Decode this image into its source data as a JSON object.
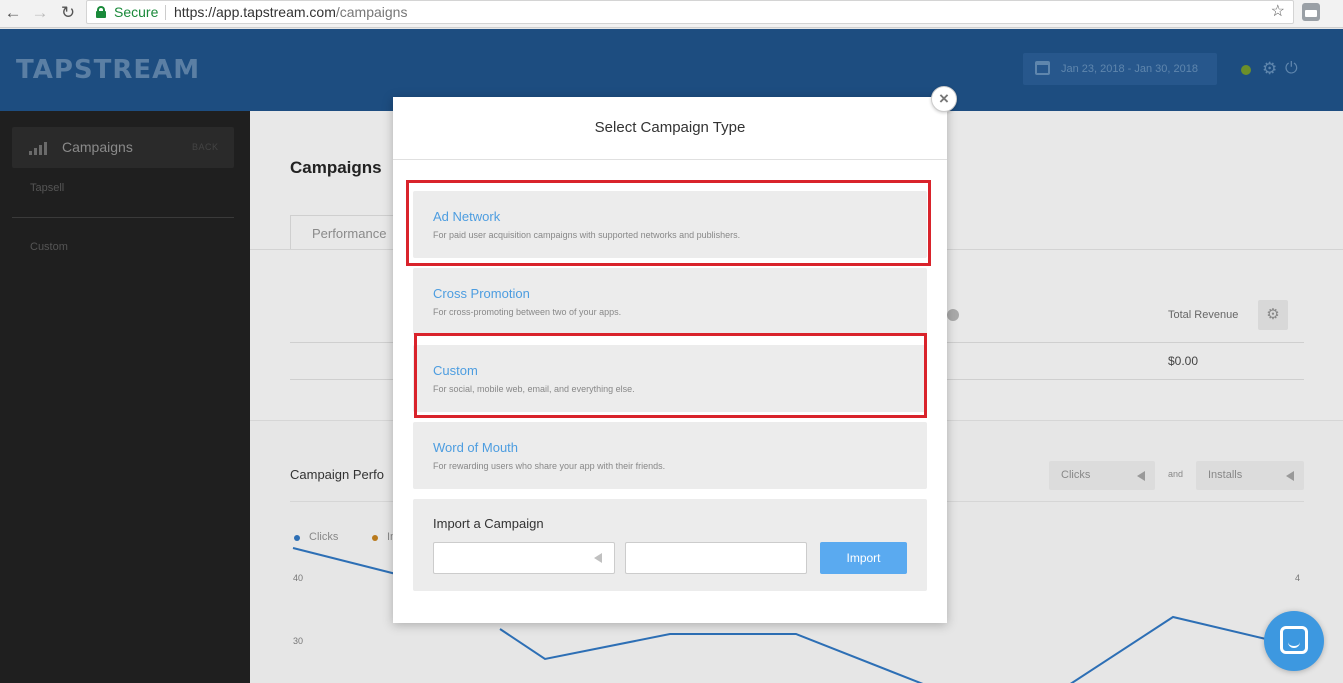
{
  "browser": {
    "secure_label": "Secure",
    "url_host": "https://app.tapstream.com",
    "url_path": "/campaigns"
  },
  "header": {
    "logo": "TAPSTREAM",
    "date_range": "Jan 23, 2018 - Jan 30, 2018"
  },
  "sidebar": {
    "campaigns_label": "Campaigns",
    "back_label": "BACK",
    "account": "Tapsell",
    "custom": "Custom"
  },
  "main": {
    "title": "Campaigns",
    "tab_performance": "Performance",
    "col_total_revenue": "Total Revenue",
    "row_total_revenue": "$0.00",
    "chart_title": "Campaign Perfo",
    "metric_a": "Clicks",
    "and": "and",
    "metric_b": "Installs",
    "legend_clicks": "Clicks",
    "legend_installs": "In",
    "y_left_top": "40",
    "y_left_bottom": "30",
    "y_right_top": "4"
  },
  "modal": {
    "title": "Select Campaign Type",
    "close_icon": "×",
    "options": [
      {
        "title": "Ad Network",
        "desc": "For paid user acquisition campaigns with supported networks and publishers."
      },
      {
        "title": "Cross Promotion",
        "desc": "For cross-promoting between two of your apps."
      },
      {
        "title": "Custom",
        "desc": "For social, mobile web, email, and everything else."
      },
      {
        "title": "Word of Mouth",
        "desc": "For rewarding users who share your app with their friends."
      }
    ],
    "import": {
      "title": "Import a Campaign",
      "button": "Import"
    }
  },
  "colors": {
    "header_bg": "#1d4d80",
    "sidebar_bg": "#1f1f1f",
    "option_title": "#4d9de0",
    "import_button": "#5aaaf0",
    "highlight": "#d9232b",
    "chat_launcher": "#3d98e0"
  },
  "icons": [
    "lock-icon",
    "star-icon",
    "calendar-icon",
    "gear-icon",
    "power-icon",
    "bar-chart-icon",
    "close-icon",
    "chat-icon"
  ]
}
